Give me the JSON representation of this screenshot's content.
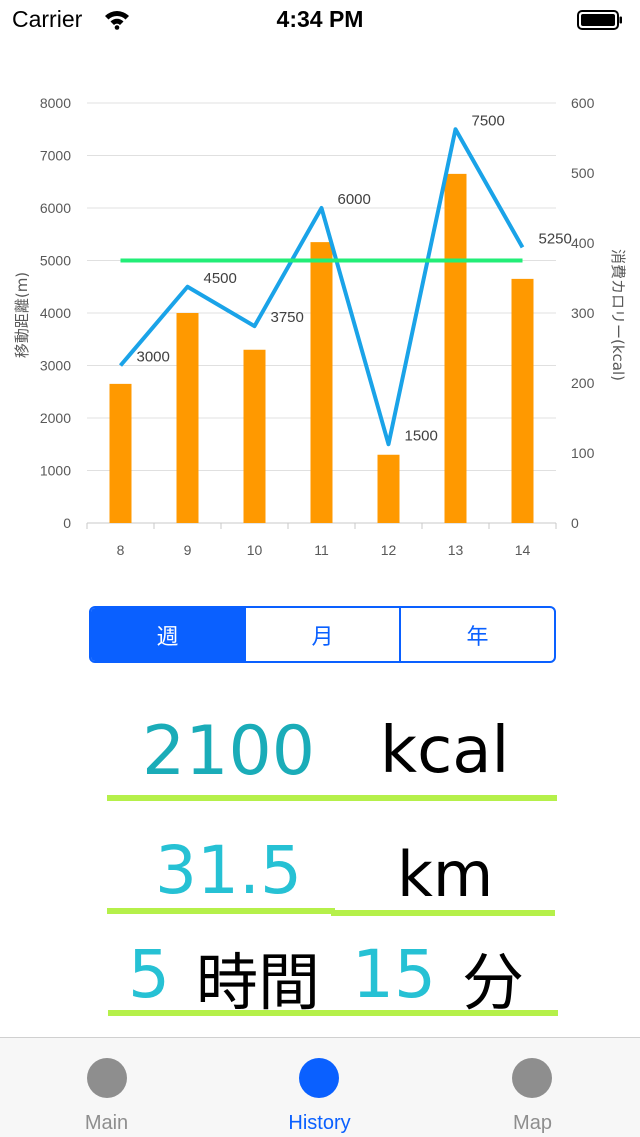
{
  "status": {
    "carrier": "Carrier",
    "time": "4:34 PM"
  },
  "chart_data": {
    "type": "bar",
    "categories": [
      "8",
      "9",
      "10",
      "11",
      "12",
      "13",
      "14"
    ],
    "series": [
      {
        "kind": "bar",
        "axis": "left",
        "color": "#ff9900",
        "values": [
          2650,
          4000,
          3300,
          5350,
          1300,
          6650,
          4650
        ]
      },
      {
        "kind": "line",
        "axis": "left",
        "color": "#1aa3e8",
        "values": [
          3000,
          4500,
          3750,
          6000,
          1500,
          7500,
          5250
        ]
      },
      {
        "kind": "line",
        "axis": "left",
        "color": "#22ee77",
        "values": [
          5000,
          5000,
          5000,
          5000,
          5000,
          5000,
          5000
        ]
      }
    ],
    "data_labels": [
      "3000",
      "4500",
      "3750",
      "6000",
      "1500",
      "7500",
      "5250"
    ],
    "ylabel": "移動距離(m)",
    "y2label": "消費カロリー(kcal)",
    "ylim": [
      0,
      8000
    ],
    "y2lim": [
      0,
      600
    ],
    "yticks": [
      "0",
      "1000",
      "2000",
      "3000",
      "4000",
      "5000",
      "6000",
      "7000",
      "8000"
    ],
    "y2ticks": [
      "0",
      "100",
      "200",
      "300",
      "400",
      "500",
      "600"
    ],
    "grid": true
  },
  "segments": [
    "週",
    "月",
    "年"
  ],
  "stats": {
    "kcal_value": "2100",
    "kcal_unit": "kcal",
    "km_value": "31.5",
    "km_unit": "km",
    "hours_value": "5",
    "hours_unit": "時間",
    "minutes_value": "15",
    "minutes_unit": "分"
  },
  "tabs": [
    "Main",
    "History",
    "Map"
  ]
}
